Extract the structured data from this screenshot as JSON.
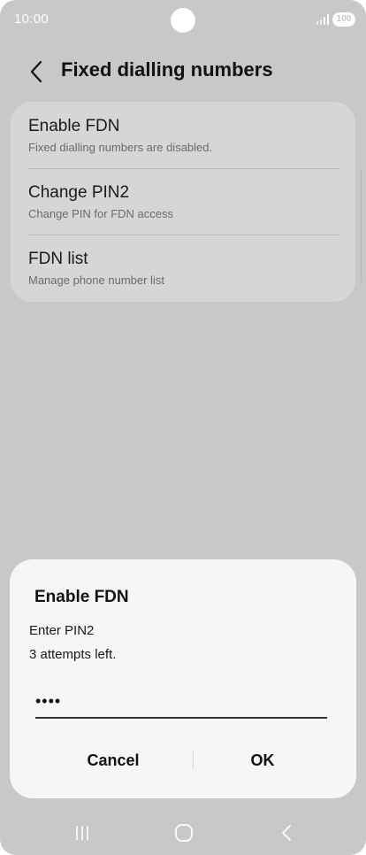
{
  "status_bar": {
    "time": "10:00",
    "battery": "100"
  },
  "header": {
    "title": "Fixed dialling numbers"
  },
  "settings": {
    "items": [
      {
        "title": "Enable FDN",
        "subtitle": "Fixed dialling numbers are disabled."
      },
      {
        "title": "Change PIN2",
        "subtitle": "Change PIN for FDN access"
      },
      {
        "title": "FDN list",
        "subtitle": "Manage phone number list"
      }
    ]
  },
  "dialog": {
    "title": "Enable FDN",
    "message_line1": "Enter PIN2",
    "message_line2": "3 attempts left.",
    "pin_value": "••••",
    "cancel_label": "Cancel",
    "ok_label": "OK"
  },
  "colors": {
    "background": "#c8c8ca",
    "card": "#d6d6d8",
    "dialog": "#f6f6f6"
  },
  "icons": {
    "back": "chevron-left-icon",
    "nav_recents": "recents-icon",
    "nav_home": "home-icon",
    "nav_back": "back-icon"
  }
}
